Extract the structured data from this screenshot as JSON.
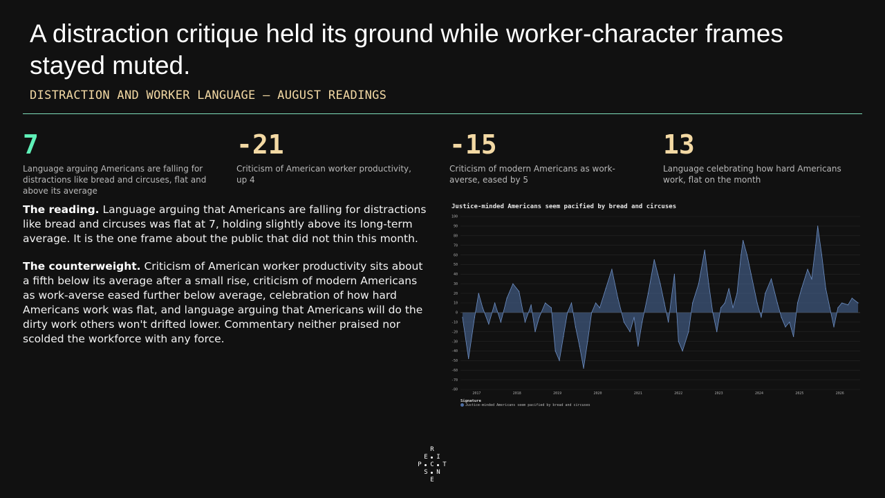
{
  "page": {
    "title": "A distraction critique held its ground while worker-character frames stayed muted.",
    "subtitle": "DISTRACTION AND WORKER LANGUAGE — AUGUST READINGS"
  },
  "kpis": [
    {
      "value": "7",
      "desc": "Language arguing Americans are falling for distractions like bread and circuses, flat and above its average"
    },
    {
      "value": "-21",
      "desc": "Criticism of American worker productivity, up 4"
    },
    {
      "value": "-15",
      "desc": "Criticism of modern Americans as work-averse, eased by 5"
    },
    {
      "value": "13",
      "desc": "Language celebrating how hard Americans work, flat on the month"
    }
  ],
  "paragraphs": [
    {
      "lead": "The reading.",
      "text": " Language arguing that Americans are falling for distractions like bread and circuses was flat at 7, holding slightly above its long-term average. It is the one frame about the public that did not thin this month."
    },
    {
      "lead": "The counterweight.",
      "text": " Criticism of American worker productivity sits about a fifth below its average after a small rise, criticism of modern Americans as work-averse eased further below average, celebration of how hard Americans work was flat, and language arguing that Americans will do the dirty work others won't drifted lower. Commentary neither praised nor scolded the workforce with any force."
    }
  ],
  "logo": {
    "letters": [
      "R",
      "E",
      "I",
      "P",
      "C",
      "T",
      "S",
      "N",
      "E"
    ]
  },
  "colors": {
    "accent": "#5ff0b8",
    "kpi": "#f3d9a4",
    "series": "#4f6fa3"
  },
  "chart_data": {
    "type": "area",
    "title": "Justice-minded Americans seem pacified by bread and circuses",
    "xlabel": "",
    "ylabel": "",
    "ylim": [
      -80,
      100
    ],
    "yticks": [
      100,
      90,
      80,
      70,
      60,
      50,
      40,
      30,
      20,
      10,
      0,
      -10,
      -20,
      -30,
      -40,
      -50,
      -60,
      -70,
      -80
    ],
    "xticks": [
      "2017",
      "2018",
      "2019",
      "2020",
      "2021",
      "2022",
      "2023",
      "2024",
      "2025",
      "2026"
    ],
    "legend_title": "Signature",
    "legend_position": "bottom-left",
    "grid": true,
    "series": [
      {
        "name": "Justice-minded Americans seem pacified by bread and circuses",
        "x": [
          2016.8,
          2016.95,
          2017.1,
          2017.2,
          2017.3,
          2017.45,
          2017.6,
          2017.75,
          2017.9,
          2018.05,
          2018.2,
          2018.35,
          2018.5,
          2018.6,
          2018.7,
          2018.85,
          2019.0,
          2019.1,
          2019.2,
          2019.3,
          2019.4,
          2019.5,
          2019.6,
          2019.7,
          2019.8,
          2019.9,
          2020.0,
          2020.1,
          2020.2,
          2020.35,
          2020.5,
          2020.65,
          2020.8,
          2020.95,
          2021.05,
          2021.15,
          2021.25,
          2021.4,
          2021.55,
          2021.7,
          2021.8,
          2021.9,
          2022.05,
          2022.15,
          2022.25,
          2022.4,
          2022.5,
          2022.65,
          2022.8,
          2022.9,
          2023.0,
          2023.1,
          2023.2,
          2023.3,
          2023.4,
          2023.5,
          2023.6,
          2023.7,
          2023.75,
          2023.85,
          2023.95,
          2024.1,
          2024.2,
          2024.3,
          2024.45,
          2024.6,
          2024.7,
          2024.8,
          2024.9,
          2025.0,
          2025.1,
          2025.2,
          2025.35,
          2025.45,
          2025.55,
          2025.6,
          2025.7,
          2025.8,
          2025.9,
          2026.0,
          2026.1,
          2026.2,
          2026.35,
          2026.45,
          2026.6
        ],
        "values": [
          -5,
          -48,
          -5,
          20,
          5,
          -12,
          10,
          -10,
          15,
          30,
          22,
          -10,
          8,
          -20,
          -5,
          10,
          5,
          -40,
          -50,
          -25,
          0,
          10,
          -15,
          -35,
          -58,
          -30,
          0,
          10,
          5,
          25,
          45,
          15,
          -10,
          -20,
          -5,
          -35,
          -10,
          20,
          55,
          30,
          10,
          -10,
          40,
          -30,
          -40,
          -20,
          10,
          30,
          65,
          30,
          0,
          -20,
          5,
          10,
          25,
          5,
          20,
          60,
          75,
          60,
          40,
          10,
          -5,
          20,
          35,
          10,
          -5,
          -15,
          -10,
          -25,
          10,
          25,
          45,
          35,
          70,
          90,
          60,
          25,
          5,
          -15,
          5,
          10,
          8,
          15,
          10
        ]
      }
    ]
  }
}
